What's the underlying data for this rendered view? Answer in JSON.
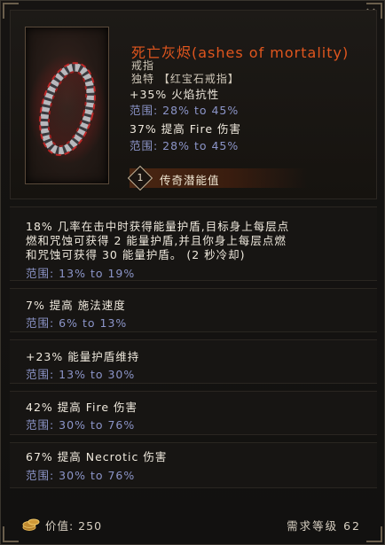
{
  "close_glyph": "✕",
  "item": {
    "name": "死亡灰烬(ashes of mortality)",
    "type": "戒指",
    "subtype": "独特 【红宝石戒指】",
    "icon": "ring-icon",
    "name_color": "#e0561e"
  },
  "implicits": [
    {
      "text": "+35% 火焰抗性",
      "range": "范围: 28% to 45%"
    },
    {
      "text": "37% 提高 Fire 伤害",
      "range": "范围: 28% to 45%"
    }
  ],
  "legendary_potential": {
    "value": "1",
    "label": "传奇潜能值"
  },
  "affixes": [
    {
      "text": "18% 几率在击中时获得能量护盾,目标身上每层点\n燃和咒蚀可获得 2 能量护盾,并且你身上每层点燃\n和咒蚀可获得 30 能量护盾。 (2 秒冷却)",
      "range": "范围: 13% to 19%"
    },
    {
      "text": "7% 提高 施法速度",
      "range": "范围: 6% to 13%"
    },
    {
      "text": "+23% 能量护盾维持",
      "range": "范围: 13% to 30%"
    },
    {
      "text": "42% 提高 Fire 伤害",
      "range": "范围: 30% to 76%"
    },
    {
      "text": "67% 提高 Necrotic 伤害",
      "range": "范围: 30% to 76%"
    }
  ],
  "footer": {
    "value": "价值: 250",
    "required_level": "需求等级 62",
    "icon": "coin-icon"
  },
  "colors": {
    "range": "#8c95c9",
    "text": "#efe9dd",
    "accent": "#e0561e"
  }
}
